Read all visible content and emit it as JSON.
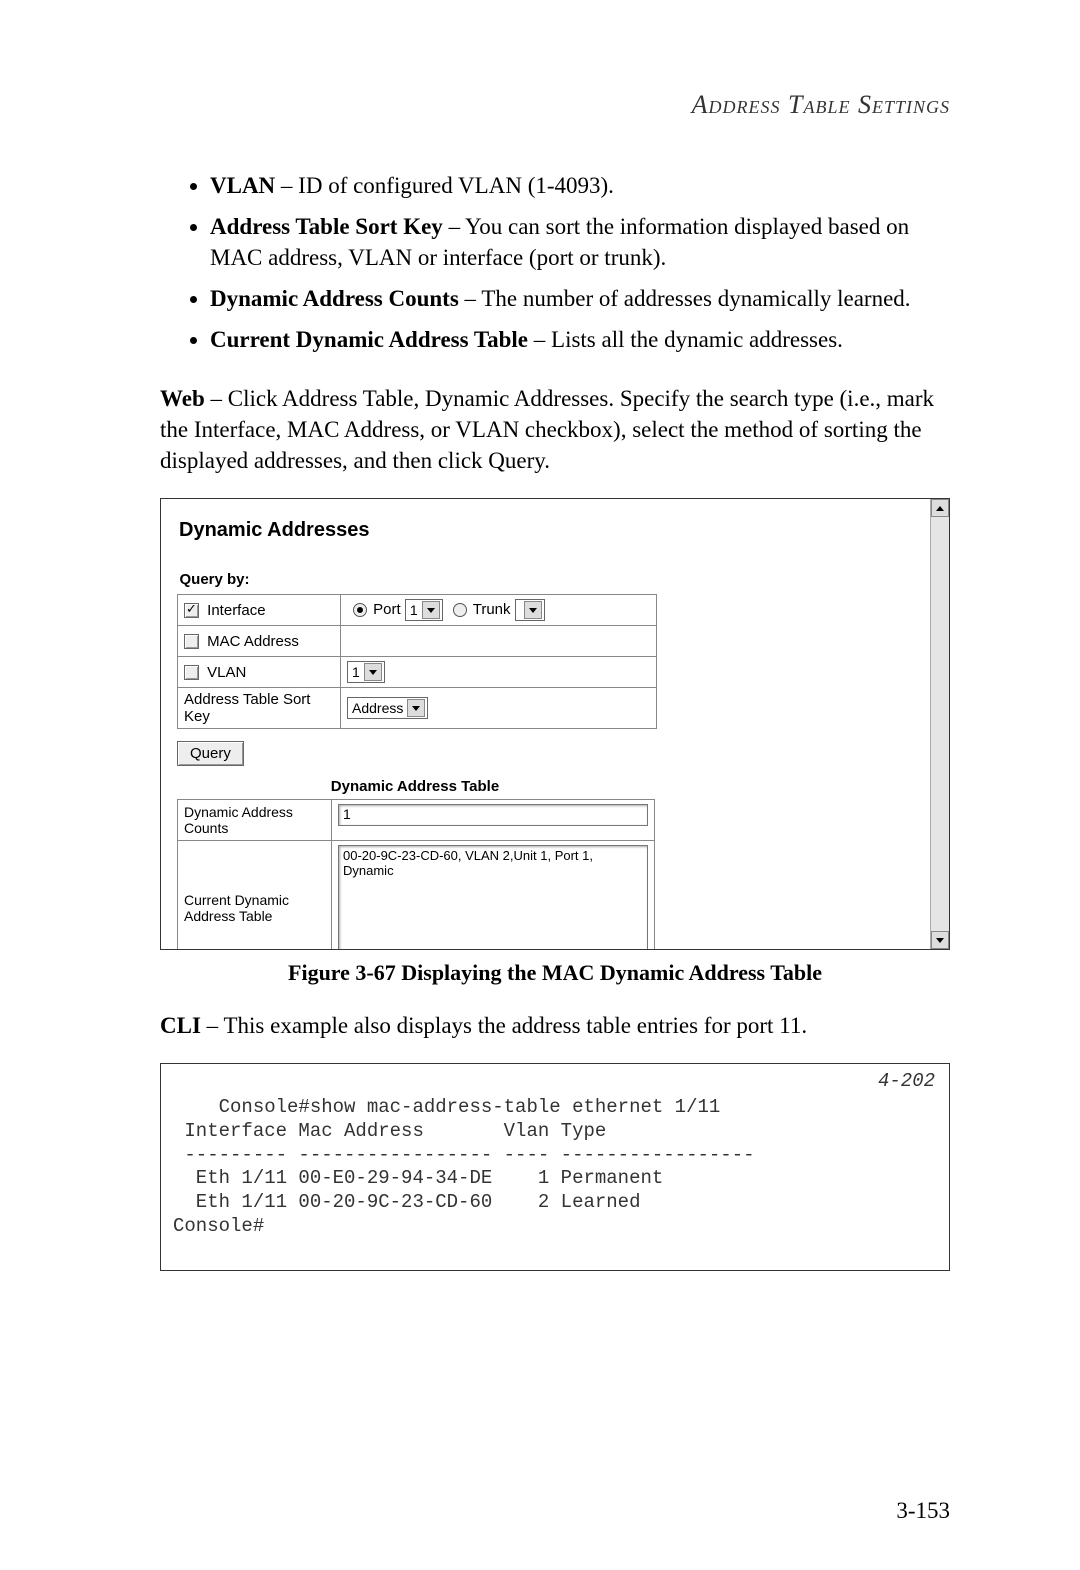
{
  "header": {
    "running_title": "Address Table Settings"
  },
  "bullets": [
    {
      "term": "VLAN",
      "desc": " – ID of configured VLAN (1-4093)."
    },
    {
      "term": "Address Table Sort Key",
      "desc": " – You can sort the information displayed based on MAC address, VLAN or interface (port or trunk)."
    },
    {
      "term": "Dynamic Address Counts",
      "desc": " – The number of addresses dynamically learned."
    },
    {
      "term": "Current Dynamic Address Table",
      "desc": " – Lists all the dynamic addresses."
    }
  ],
  "web_para": {
    "lead": "Web",
    "rest": " – Click Address Table, Dynamic Addresses. Specify the search type (i.e., mark the Interface, MAC Address, or VLAN checkbox), select the method of sorting the displayed addresses, and then click Query."
  },
  "screenshot": {
    "title": "Dynamic Addresses",
    "query_by_label": "Query by:",
    "rows": {
      "interface": {
        "label": "Interface",
        "checked": true,
        "port_label": "Port",
        "port_value": "1",
        "trunk_label": "Trunk",
        "trunk_value": ""
      },
      "mac": {
        "label": "MAC Address",
        "checked": false
      },
      "vlan": {
        "label": "VLAN",
        "checked": false,
        "value": "1"
      },
      "sortkey": {
        "label": "Address Table Sort Key",
        "value": "Address"
      }
    },
    "query_btn": "Query",
    "table_section_title": "Dynamic Address Table",
    "counts_label": "Dynamic Address Counts",
    "counts_value": "1",
    "current_label": "Current Dynamic Address Table",
    "entries": [
      "00-20-9C-23-CD-60, VLAN 2,Unit 1, Port 1, Dynamic"
    ]
  },
  "figure_caption": "Figure 3-67   Displaying the MAC Dynamic Address Table",
  "cli_para": {
    "lead": "CLI",
    "rest": " – This example also displays the address table entries for port 11."
  },
  "cli": {
    "ref": "4-202",
    "text": "Console#show mac-address-table ethernet 1/11\n Interface Mac Address       Vlan Type\n --------- ----------------- ---- -----------------\n  Eth 1/11 00-E0-29-94-34-DE    1 Permanent\n  Eth 1/11 00-20-9C-23-CD-60    2 Learned\nConsole#"
  },
  "page_number": "3-153"
}
